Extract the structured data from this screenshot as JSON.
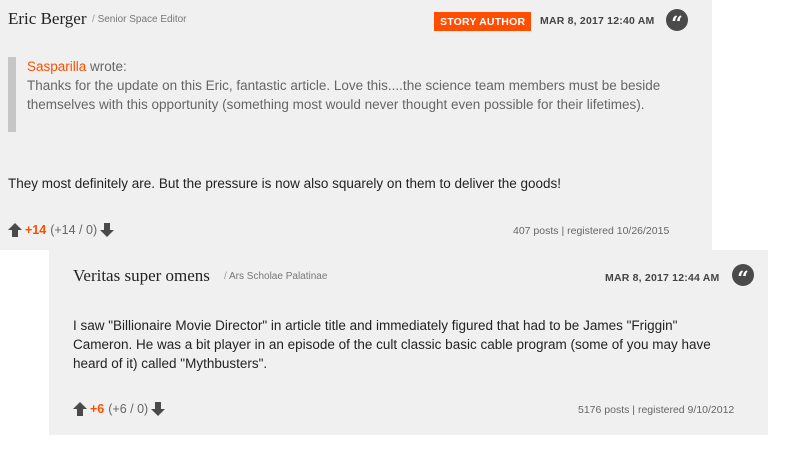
{
  "comments": [
    {
      "author": "Eric Berger",
      "role": "Senior Space Editor",
      "badge": "STORY AUTHOR",
      "date": "MAR 8, 2017 12:40 AM",
      "quote": {
        "who": "Sasparilla",
        "wrote": "wrote:",
        "text": "Thanks for the update on this Eric, fantastic article. Love this....the science team members must be beside themselves with this opportunity (something most would never thought even possible for their lifetimes)."
      },
      "body": "They most definitely are. But the pressure is now also squarely on them to deliver the goods!",
      "score": "+14",
      "breakdown": "(+14 / 0)",
      "posts": "407 posts",
      "registered": "registered 10/26/2015"
    },
    {
      "author": "Veritas super omens",
      "role": "Ars Scholae Palatinae",
      "date": "MAR 8, 2017 12:44 AM",
      "body": "I saw \"Billionaire Movie Director\" in article title and immediately figured that had to be James \"Friggin\" Cameron. He was a bit player in an episode of the cult classic basic cable program (some of you may have heard of it) called \"Mythbusters\".",
      "score": "+6",
      "breakdown": "(+6 / 0)",
      "posts": "5176 posts",
      "registered": "registered 9/10/2012"
    }
  ],
  "ui": {
    "role_separator": "/",
    "meta_separator": "|",
    "quote_glyph": "“"
  },
  "colors": {
    "accent": "#ff4e00",
    "panel": "#f0f0f0",
    "icon": "#4a4a4a"
  }
}
